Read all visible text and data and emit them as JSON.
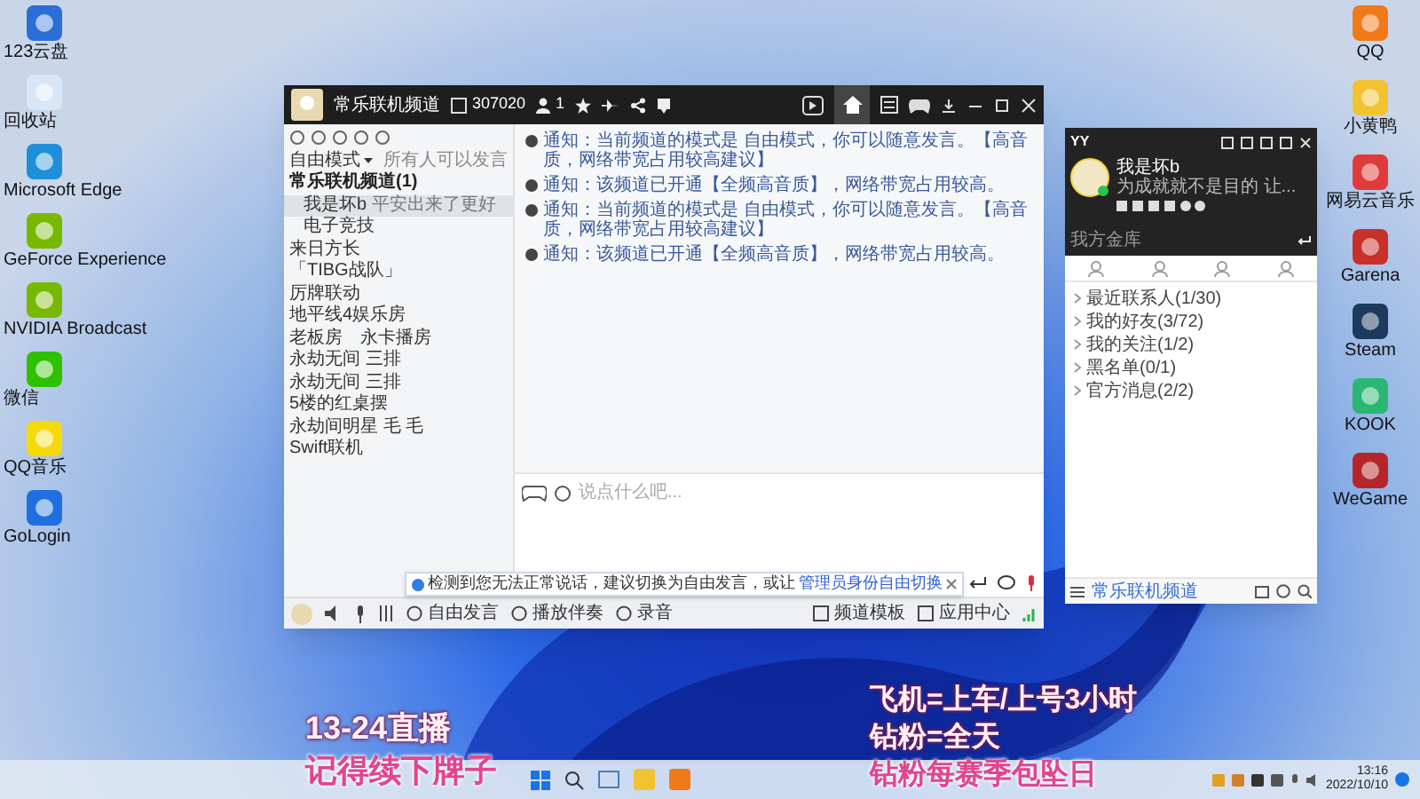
{
  "desktop_icons_left": [
    {
      "label": "123云盘"
    },
    {
      "label": "回收站"
    },
    {
      "label": "Microsoft Edge"
    },
    {
      "label": "GeForce Experience"
    },
    {
      "label": "NVIDIA Broadcast"
    },
    {
      "label": "微信"
    },
    {
      "label": "QQ音乐"
    },
    {
      "label": "GoLogin"
    }
  ],
  "desktop_icons_right": [
    {
      "label": "QQ",
      "color": "#f07a1a"
    },
    {
      "label": "小黄鸭",
      "color": "#f2c230"
    },
    {
      "label": "网易云音乐",
      "color": "#e03a3a"
    },
    {
      "label": "Garena",
      "color": "#c8312a"
    },
    {
      "label": "Steam",
      "color": "#1b3a5c"
    },
    {
      "label": "KOOK",
      "color": "#2bb673"
    },
    {
      "label": "WeGame",
      "color": "#b5262a"
    }
  ],
  "main_window": {
    "channel_title": "常乐联机频道",
    "channel_id": "307020",
    "online_count": "1",
    "mode": "自由模式",
    "speak_rule": "所有人可以发言",
    "tree": [
      {
        "label": "常乐联机频道(1)",
        "selected": false,
        "children": [
          {
            "label": "我是坏b",
            "selected": true,
            "status": "平安出来了更好"
          },
          {
            "label": "电子竞技",
            "selected": false
          }
        ]
      },
      {
        "label": "来日方长",
        "selected": false
      },
      {
        "label": "「TIBG战队」",
        "selected": false
      },
      {
        "label": "厉牌联动",
        "selected": false
      },
      {
        "label": "地平线4娱乐房",
        "selected": false
      },
      {
        "label": "老板房　永卡播房",
        "selected": false
      },
      {
        "label": "永劫无间 三排",
        "selected": false
      },
      {
        "label": "永劫无间 三排",
        "selected": false
      },
      {
        "label": "5楼的红桌摆",
        "selected": false
      },
      {
        "label": "永劫间明星 毛 毛",
        "selected": false
      },
      {
        "label": "Swift联机",
        "selected": false
      }
    ],
    "messages": [
      "通知：当前频道的模式是 自由模式，你可以随意发言。【高音质，网络带宽占用较高建议】",
      "通知：该频道已开通【全频高音质】，网络带宽占用较高。",
      "通知：当前频道的模式是 自由模式，你可以随意发言。【高音质，网络带宽占用较高建议】",
      "通知：该频道已开通【全频高音质】，网络带宽占用较高。"
    ],
    "input_placeholder": "说点什么吧...",
    "tooltip": {
      "text": "检测到您无法正常说话，建议切换为自由发言，或让",
      "link": "管理员身份自由切换"
    },
    "toolbar": [
      "自由发言",
      "播放伴奏",
      "录音"
    ],
    "right_tools": [
      "频道模板",
      "应用中心"
    ]
  },
  "yy_panel": {
    "app_title": "YY",
    "username": "我是坏b",
    "signature": "为成就就不是目的 让...",
    "search_hint": "我方金库",
    "groups": [
      "最近联系人(1/30)",
      "我的好友(3/72)",
      "我的关注(1/2)",
      "黑名单(0/1)",
      "官方消息(2/2)"
    ],
    "channel_link": "常乐联机频道"
  },
  "overlay": {
    "left": [
      "13-24直播",
      "记得续下牌子"
    ],
    "right": [
      "飞机=上车/上号3小时",
      "钻粉=全天",
      "钻粉每赛季包坠日"
    ]
  },
  "taskbar": {
    "time": "13:16",
    "date": "2022/10/10"
  }
}
